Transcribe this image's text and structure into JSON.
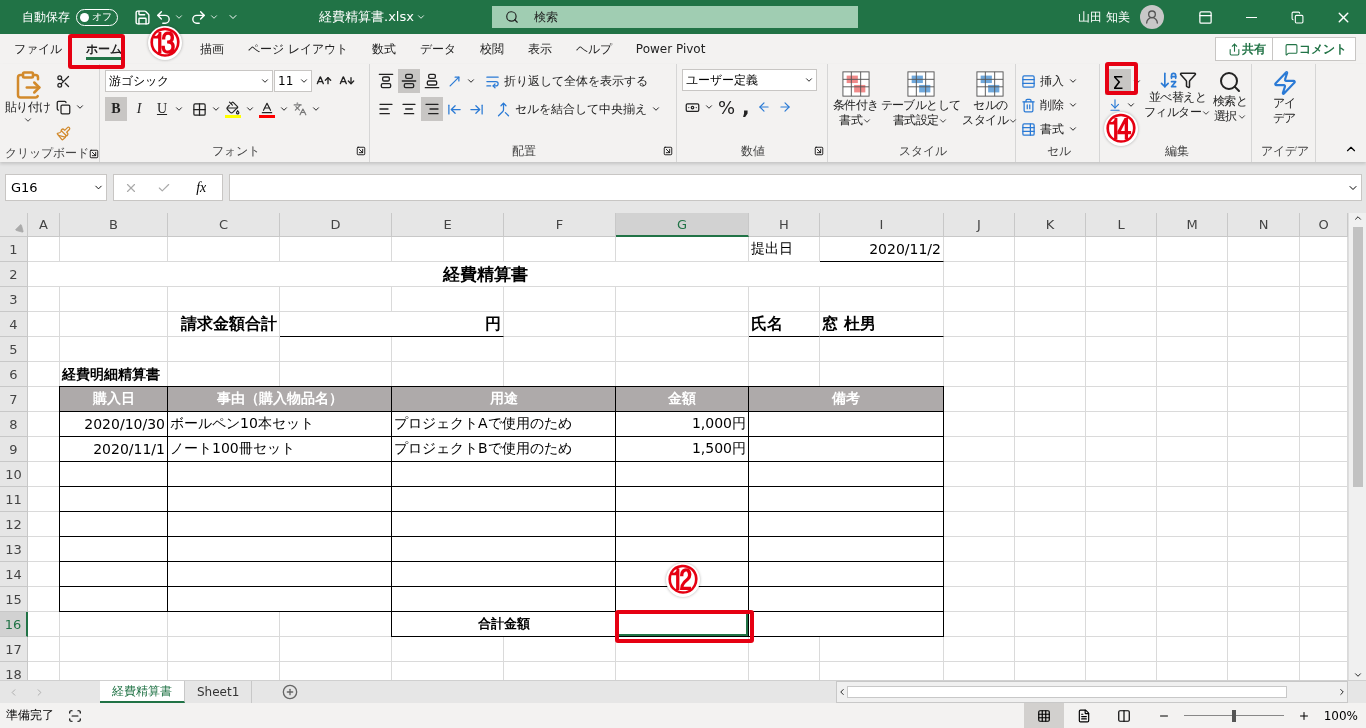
{
  "titlebar": {
    "autosave_label": "自動保存",
    "autosave": {
      "on": false,
      "label": "オフ"
    },
    "filename": "経費精算書.xlsx",
    "search": {
      "placeholder": "検索"
    },
    "user": "山田 知美"
  },
  "tabs": [
    {
      "label": "ファイル",
      "selected": false
    },
    {
      "label": "ホーム",
      "selected": true
    },
    {
      "label": "描画",
      "selected": false
    },
    {
      "label": "ページ レイアウト",
      "selected": false
    },
    {
      "label": "数式",
      "selected": false
    },
    {
      "label": "データ",
      "selected": false
    },
    {
      "label": "校閲",
      "selected": false
    },
    {
      "label": "表示",
      "selected": false
    },
    {
      "label": "ヘルプ",
      "selected": false
    },
    {
      "label": "Power Pivot",
      "selected": false
    }
  ],
  "share_button": "共有",
  "comment_button": "コメント",
  "ribbon": {
    "clipboard": {
      "paste": "貼り付け",
      "label": "クリップボード"
    },
    "font": {
      "name": "游ゴシック",
      "size": "11",
      "styles": [
        {
          "label": "B",
          "selected": true
        },
        {
          "label": "I",
          "selected": false
        },
        {
          "label": "U",
          "selected": false
        }
      ],
      "label": "フォント"
    },
    "alignment": {
      "vertical": [
        {
          "selected": false
        },
        {
          "selected": true
        },
        {
          "selected": false
        }
      ],
      "horizontal": [
        {
          "selected": false
        },
        {
          "selected": false
        },
        {
          "selected": true
        }
      ],
      "wrap": "折り返して全体を表示する",
      "merge": "セルを結合して中央揃え",
      "label": "配置"
    },
    "number": {
      "format": "ユーザー定義",
      "percent": "%",
      "comma": ",",
      "label": "数値"
    },
    "styles": {
      "buttons": [
        {
          "lines": [
            "条件付き",
            "書式"
          ]
        },
        {
          "lines": [
            "テーブルとして",
            "書式設定"
          ]
        },
        {
          "lines": [
            "セルの",
            "スタイル"
          ]
        }
      ],
      "label": "スタイル"
    },
    "cells": {
      "buttons": [
        "挿入",
        "削除",
        "書式"
      ],
      "label": "セル"
    },
    "editing": {
      "autosum": "Σ",
      "sort": [
        "並べ替えと",
        "フィルター"
      ],
      "find": [
        "検索と",
        "選択"
      ],
      "label": "編集"
    },
    "ideas": {
      "lines": [
        "アイ",
        "デア"
      ],
      "label": "アイデア"
    }
  },
  "formula_bar": {
    "cell": "G16",
    "fx": "fx"
  },
  "sheet": {
    "columns": [
      {
        "label": "A",
        "selected": false
      },
      {
        "label": "B",
        "selected": false
      },
      {
        "label": "C",
        "selected": false
      },
      {
        "label": "D",
        "selected": false
      },
      {
        "label": "E",
        "selected": false
      },
      {
        "label": "F",
        "selected": false
      },
      {
        "label": "G",
        "selected": true
      },
      {
        "label": "H",
        "selected": false
      },
      {
        "label": "I",
        "selected": false
      },
      {
        "label": "J",
        "selected": false
      },
      {
        "label": "K",
        "selected": false
      },
      {
        "label": "L",
        "selected": false
      },
      {
        "label": "M",
        "selected": false
      },
      {
        "label": "N",
        "selected": false
      },
      {
        "label": "O",
        "selected": false
      }
    ],
    "rows": [
      {
        "label": "1",
        "selected": false
      },
      {
        "label": "2",
        "selected": false
      },
      {
        "label": "3",
        "selected": false
      },
      {
        "label": "4",
        "selected": false
      },
      {
        "label": "5",
        "selected": false
      },
      {
        "label": "6",
        "selected": false
      },
      {
        "label": "7",
        "selected": false
      },
      {
        "label": "8",
        "selected": false
      },
      {
        "label": "9",
        "selected": false
      },
      {
        "label": "10",
        "selected": false
      },
      {
        "label": "11",
        "selected": false
      },
      {
        "label": "12",
        "selected": false
      },
      {
        "label": "13",
        "selected": false
      },
      {
        "label": "14",
        "selected": false
      },
      {
        "label": "15",
        "selected": false
      },
      {
        "label": "16",
        "selected": true
      },
      {
        "label": "17",
        "selected": false
      },
      {
        "label": "18",
        "selected": false
      }
    ],
    "form": {
      "date_label": "提出日",
      "date": "2020/11/2",
      "title": "経費精算書",
      "total_label": "請求金額合計",
      "yen": "円",
      "name_label": "氏名",
      "name": "窓 杜男",
      "section": "経費明細精算書"
    },
    "table": {
      "columns": [
        "購入日",
        "事由（購入物品名）",
        "用途",
        "金額",
        "備考"
      ],
      "rows": [
        {
          "kind": "entry",
          "cells": [
            "2020/10/30",
            "ボールペン10本セット",
            "プロジェクトAで使用のため",
            "1,000円"
          ]
        },
        {
          "kind": "entry",
          "cells": [
            "2020/11/1",
            "ノート100冊セット",
            "プロジェクトBで使用のため",
            "1,500円"
          ]
        },
        {
          "kind": "blank"
        },
        {
          "kind": "blank"
        },
        {
          "kind": "blank"
        },
        {
          "kind": "blank"
        },
        {
          "kind": "blank"
        },
        {
          "kind": "blank"
        }
      ]
    },
    "total": {
      "label": "合計金額",
      "selected": true
    }
  },
  "sheet_tabs": [
    {
      "label": "経費精算書",
      "selected": true
    },
    {
      "label": "Sheet1",
      "selected": false
    }
  ],
  "status": {
    "text": "準備完了",
    "views": [
      {
        "selected": true
      },
      {
        "selected": false
      },
      {
        "selected": false
      }
    ],
    "zoom": {
      "level": 0.5,
      "reading": "100%"
    }
  },
  "annotations": [
    {
      "kind": "box"
    },
    {
      "kind": "circle",
      "text": "⑬"
    },
    {
      "kind": "box"
    },
    {
      "kind": "circle",
      "text": "⑭"
    },
    {
      "kind": "circle",
      "text": "⑫"
    },
    {
      "kind": "box"
    }
  ]
}
